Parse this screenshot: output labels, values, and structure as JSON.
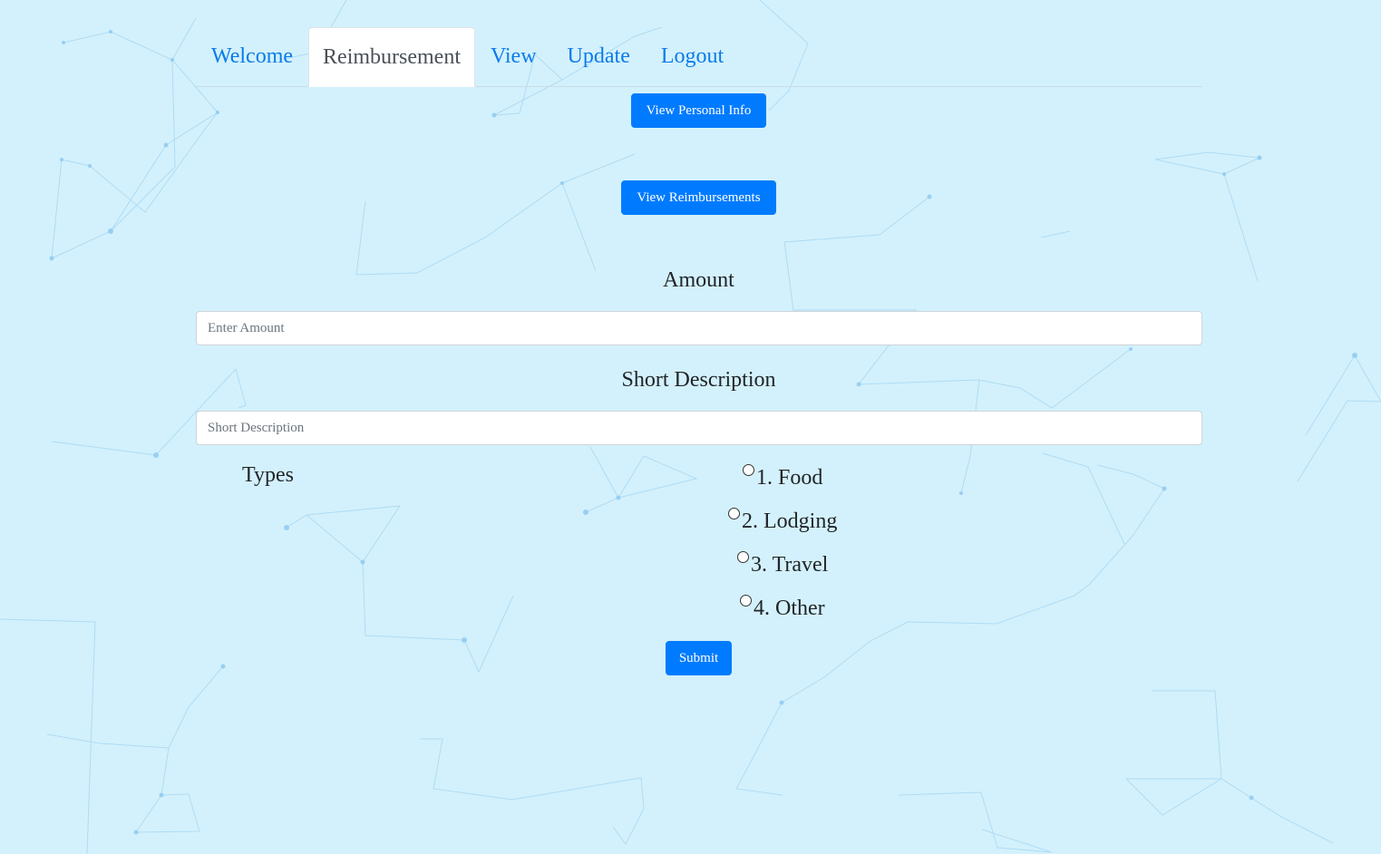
{
  "nav": {
    "tabs": [
      {
        "label": "Welcome",
        "active": false
      },
      {
        "label": "Reimbursement",
        "active": true
      },
      {
        "label": "View",
        "active": false
      },
      {
        "label": "Update",
        "active": false
      },
      {
        "label": "Logout",
        "active": false
      }
    ]
  },
  "buttons": {
    "view_personal_info": "View Personal Info",
    "view_reimbursements": "View Reimbursements",
    "submit": "Submit"
  },
  "form": {
    "amount_label": "Amount",
    "amount_placeholder": "Enter Amount",
    "amount_value": "",
    "description_label": "Short Description",
    "description_placeholder": "Short Description",
    "description_value": "",
    "types_label": "Types",
    "types": [
      {
        "label": "1. Food",
        "checked": false
      },
      {
        "label": "2. Lodging",
        "checked": false
      },
      {
        "label": "3. Travel",
        "checked": false
      },
      {
        "label": "4. Other",
        "checked": false
      }
    ]
  },
  "colors": {
    "background": "#d3f1fc",
    "primary": "#007bff",
    "link": "#0a7bea"
  }
}
